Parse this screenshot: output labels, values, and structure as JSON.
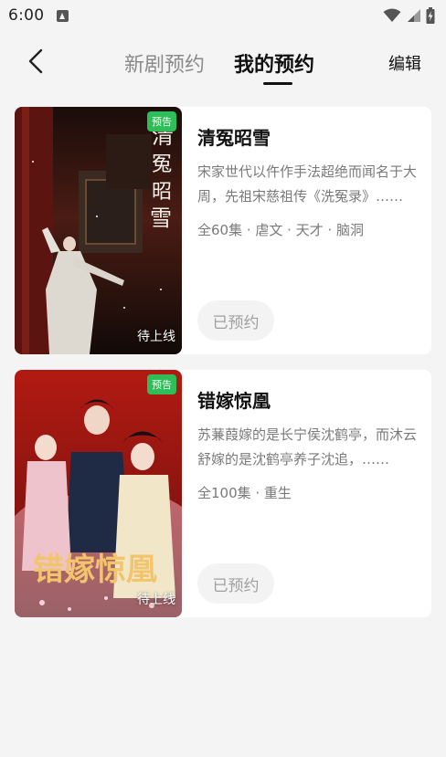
{
  "status_bar": {
    "time": "6:00"
  },
  "header": {
    "tabs": [
      {
        "label": "新剧预约",
        "active": false
      },
      {
        "label": "我的预约",
        "active": true
      }
    ],
    "edit_label": "编辑"
  },
  "reservations": [
    {
      "title": "清冤昭雪",
      "description": "宋家世代以仵作手法超绝而闻名于大周，先祖宋慈祖传《洗冤录》……",
      "tags": "全60集 · 虐文 · 天才 · 脑洞",
      "badge": "预告",
      "poster_status": "待上线",
      "poster_title": "清冤昭雪",
      "button_label": "已预约"
    },
    {
      "title": "错嫁惊凰",
      "description": "苏蒹葭嫁的是长宁侯沈鹤亭，而沐云舒嫁的是沈鹤亭养子沈追，……",
      "tags": "全100集 · 重生",
      "badge": "预告",
      "poster_status": "待上线",
      "poster_title": "错嫁惊凰",
      "button_label": "已预约"
    }
  ],
  "colors": {
    "badge_green": "#2fbd57",
    "background": "#f4f4f4",
    "card": "#ffffff",
    "muted_text": "#7a7a7a"
  }
}
